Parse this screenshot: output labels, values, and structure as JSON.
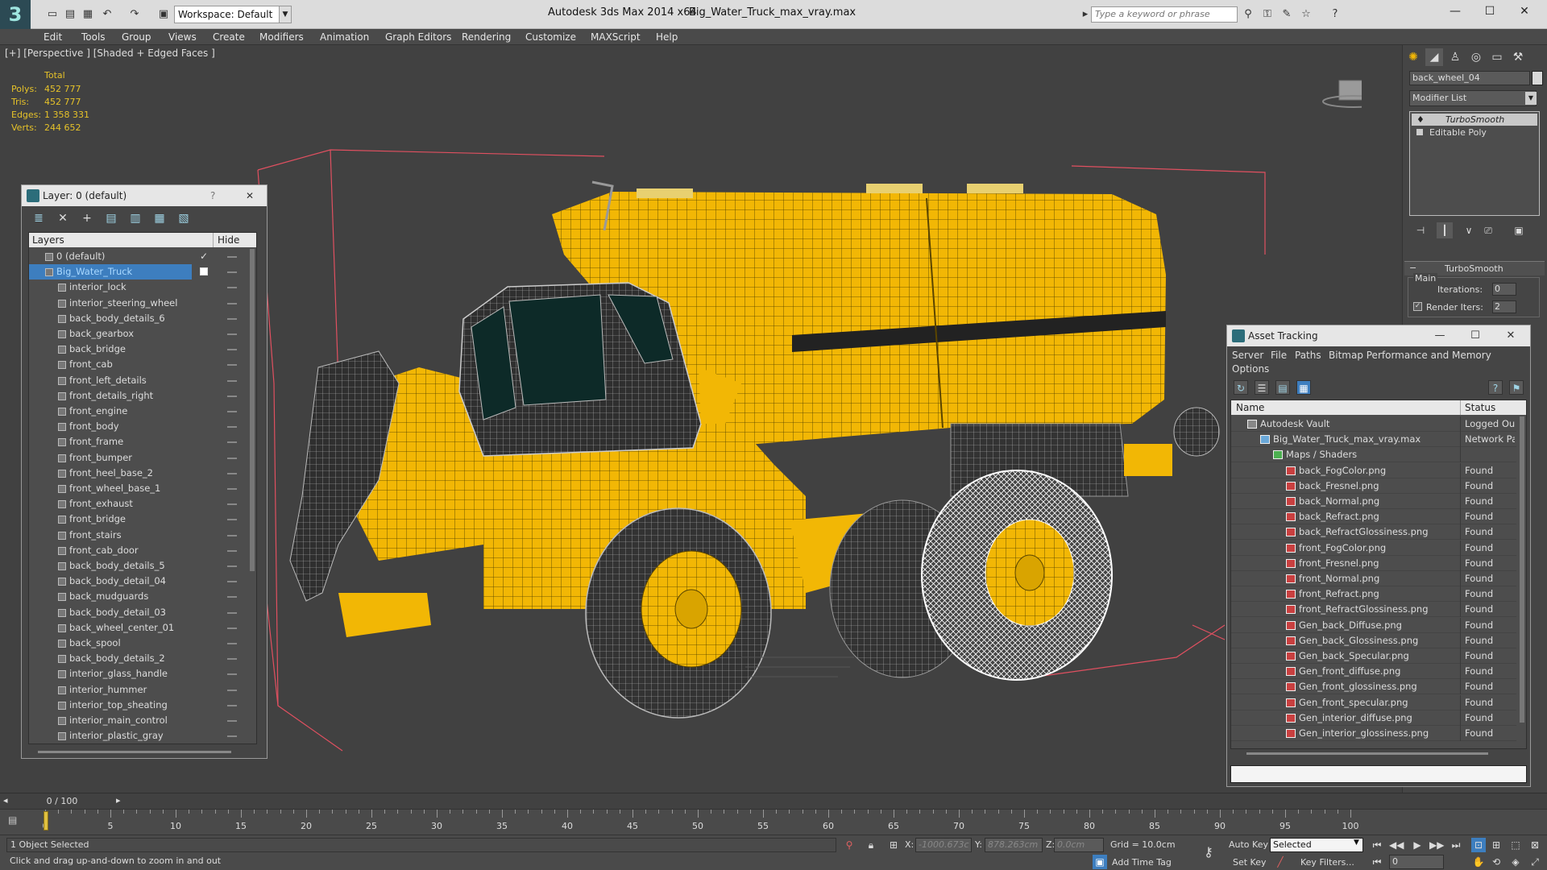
{
  "titlebar": {
    "app_title": "Autodesk 3ds Max  2014 x64",
    "doc_title": "Big_Water_Truck_max_vray.max",
    "workspace": "Workspace: Default",
    "search_placeholder": "Type a keyword or phrase",
    "logo": "3"
  },
  "menu": [
    "Edit",
    "Tools",
    "Group",
    "Views",
    "Create",
    "Modifiers",
    "Animation",
    "Graph Editors",
    "Rendering",
    "Customize",
    "MAXScript",
    "Help"
  ],
  "viewport": {
    "label": "[+] [Perspective ] [Shaded + Edged Faces ]",
    "stats_total": "Total",
    "stats": [
      {
        "label": "Polys:",
        "value": "452 777"
      },
      {
        "label": "Tris:",
        "value": "452 777"
      },
      {
        "label": "Edges:",
        "value": "1 358 331"
      },
      {
        "label": "Verts:",
        "value": "244 652"
      }
    ],
    "model_color": "#f2b705",
    "bbox_color": "#e05060"
  },
  "layer_panel": {
    "title": "Layer: 0 (default)",
    "help": "?",
    "close": "✕",
    "col_layers": "Layers",
    "col_hide": "Hide",
    "rows": [
      {
        "name": "0 (default)",
        "type": "layer",
        "checked": true
      },
      {
        "name": "Big_Water_Truck",
        "type": "layer",
        "selected": true
      },
      {
        "name": "interior_lock"
      },
      {
        "name": "interior_steering_wheel"
      },
      {
        "name": "back_body_details_6"
      },
      {
        "name": "back_gearbox"
      },
      {
        "name": "back_bridge"
      },
      {
        "name": "front_cab"
      },
      {
        "name": "front_left_details"
      },
      {
        "name": "front_details_right"
      },
      {
        "name": "front_engine"
      },
      {
        "name": "front_body"
      },
      {
        "name": "front_frame"
      },
      {
        "name": "front_bumper"
      },
      {
        "name": "front_heel_base_2"
      },
      {
        "name": "front_wheel_base_1"
      },
      {
        "name": "front_exhaust"
      },
      {
        "name": "front_bridge"
      },
      {
        "name": "front_stairs"
      },
      {
        "name": "front_cab_door"
      },
      {
        "name": "back_body_details_5"
      },
      {
        "name": "back_body_detail_04"
      },
      {
        "name": "back_mudguards"
      },
      {
        "name": "back_body_detail_03"
      },
      {
        "name": "back_wheel_center_01"
      },
      {
        "name": "back_spool"
      },
      {
        "name": "back_body_details_2"
      },
      {
        "name": "interior_glass_handle"
      },
      {
        "name": "interior_hummer"
      },
      {
        "name": "interior_top_sheating"
      },
      {
        "name": "interior_main_control"
      },
      {
        "name": "interior_plastic_gray"
      }
    ]
  },
  "command_panel": {
    "object_name": "back_wheel_04",
    "modifier_list": "Modifier List",
    "stack": [
      "TurboSmooth",
      "Editable Poly"
    ],
    "rollout_title": "TurboSmooth",
    "main_label": "Main",
    "iterations_label": "Iterations:",
    "iterations_value": "0",
    "render_iters_label": "Render Iters:",
    "render_iters_value": "2"
  },
  "asset_panel": {
    "title": "Asset Tracking",
    "menu": [
      "Server",
      "File",
      "Paths",
      "Bitmap Performance and Memory",
      "Options"
    ],
    "col_name": "Name",
    "col_status": "Status",
    "rows": [
      {
        "name": "Autodesk Vault",
        "status": "Logged Out",
        "indent": 0,
        "kind": "vault"
      },
      {
        "name": "Big_Water_Truck_max_vray.max",
        "status": "Network Pat",
        "indent": 1,
        "kind": "file"
      },
      {
        "name": "Maps / Shaders",
        "status": "",
        "indent": 2,
        "kind": "folder"
      },
      {
        "name": "back_FogColor.png",
        "status": "Found",
        "indent": 3
      },
      {
        "name": "back_Fresnel.png",
        "status": "Found",
        "indent": 3
      },
      {
        "name": "back_Normal.png",
        "status": "Found",
        "indent": 3
      },
      {
        "name": "back_Refract.png",
        "status": "Found",
        "indent": 3
      },
      {
        "name": "back_RefractGlossiness.png",
        "status": "Found",
        "indent": 3
      },
      {
        "name": "front_FogColor.png",
        "status": "Found",
        "indent": 3
      },
      {
        "name": "front_Fresnel.png",
        "status": "Found",
        "indent": 3
      },
      {
        "name": "front_Normal.png",
        "status": "Found",
        "indent": 3
      },
      {
        "name": "front_Refract.png",
        "status": "Found",
        "indent": 3
      },
      {
        "name": "front_RefractGlossiness.png",
        "status": "Found",
        "indent": 3
      },
      {
        "name": "Gen_back_Diffuse.png",
        "status": "Found",
        "indent": 3
      },
      {
        "name": "Gen_back_Glossiness.png",
        "status": "Found",
        "indent": 3
      },
      {
        "name": "Gen_back_Specular.png",
        "status": "Found",
        "indent": 3
      },
      {
        "name": "Gen_front_diffuse.png",
        "status": "Found",
        "indent": 3
      },
      {
        "name": "Gen_front_glossiness.png",
        "status": "Found",
        "indent": 3
      },
      {
        "name": "Gen_front_specular.png",
        "status": "Found",
        "indent": 3
      },
      {
        "name": "Gen_interior_diffuse.png",
        "status": "Found",
        "indent": 3
      },
      {
        "name": "Gen_interior_glossiness.png",
        "status": "Found",
        "indent": 3
      }
    ]
  },
  "timeline": {
    "frame": "0 / 100",
    "ticks": [
      0,
      5,
      10,
      15,
      20,
      25,
      30,
      35,
      40,
      45,
      50,
      55,
      60,
      65,
      70,
      75,
      80,
      85,
      90,
      95,
      100
    ]
  },
  "status": {
    "selection": "1 Object Selected",
    "prompt": "Click and drag up-and-down to zoom in and out",
    "x_label": "X:",
    "x_value": "-1000.673c",
    "y_label": "Y:",
    "y_value": "878.263cm",
    "z_label": "Z:",
    "z_value": "0.0cm",
    "grid": "Grid = 10.0cm",
    "auto_key": "Auto Key",
    "auto_key_mode": "Selected",
    "set_key": "Set Key",
    "key_filters": "Key Filters...",
    "add_time_tag": "Add Time Tag",
    "frame_value": "0"
  }
}
